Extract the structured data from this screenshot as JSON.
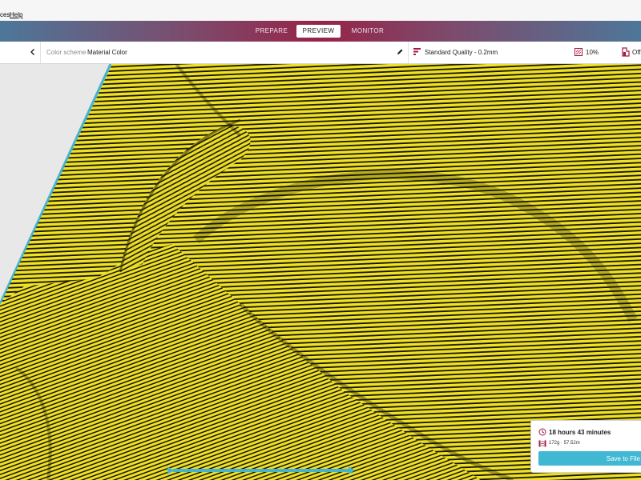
{
  "menubar": {
    "items": [
      {
        "label": "ces"
      },
      {
        "label": "Help"
      }
    ]
  },
  "stages": {
    "tabs": [
      {
        "label": "PREPARE",
        "active": false
      },
      {
        "label": "PREVIEW",
        "active": true
      },
      {
        "label": "MONITOR",
        "active": false
      }
    ]
  },
  "toolbar": {
    "color_scheme_label": "Color scheme",
    "color_scheme_value": "Material Color",
    "quality_profile": "Standard Quality - 0.2mm",
    "infill_percent": "10%",
    "support_value": "Off"
  },
  "print_info": {
    "time": "18 hours 43 minutes",
    "material_usage": "172g · 57.52m",
    "save_label": "Save to File"
  },
  "colors": {
    "model_fill": "#efe028",
    "layer_line": "#141400",
    "build_plate_edge": "#45b3cf",
    "accent": "#40b8d3",
    "header_center": "#962448",
    "header_edge": "#4d7799"
  },
  "icons": {
    "back": "chevron-left-icon",
    "edit": "pencil-icon",
    "quality": "quality-profile-icon",
    "infill": "infill-icon",
    "support": "support-icon",
    "clock": "clock-icon",
    "spool": "filament-spool-icon"
  }
}
